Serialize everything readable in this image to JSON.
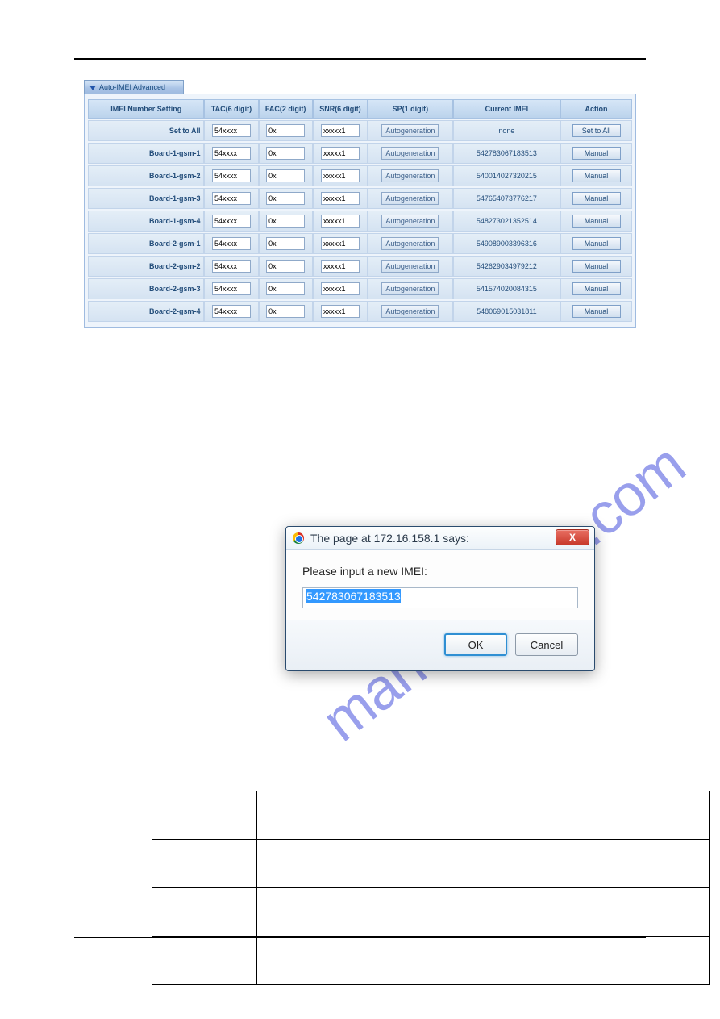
{
  "panel_title": "Auto-IMEI Advanced",
  "headers": {
    "setting": "IMEI Number Setting",
    "tac": "TAC(6 digit)",
    "fac": "FAC(2 digit)",
    "snr": "SNR(6 digit)",
    "sp": "SP(1 digit)",
    "current": "Current IMEI",
    "action": "Action"
  },
  "autogen_label": "Autogeneration",
  "set_to_all_label": "Set to All",
  "manual_label": "Manual",
  "rows": [
    {
      "label": "Set to All",
      "tac": "54xxxx",
      "fac": "0x",
      "snr": "xxxxx1",
      "imei": "none",
      "action": "settoall"
    },
    {
      "label": "Board-1-gsm-1",
      "tac": "54xxxx",
      "fac": "0x",
      "snr": "xxxxx1",
      "imei": "542783067183513",
      "action": "manual"
    },
    {
      "label": "Board-1-gsm-2",
      "tac": "54xxxx",
      "fac": "0x",
      "snr": "xxxxx1",
      "imei": "540014027320215",
      "action": "manual"
    },
    {
      "label": "Board-1-gsm-3",
      "tac": "54xxxx",
      "fac": "0x",
      "snr": "xxxxx1",
      "imei": "547654073776217",
      "action": "manual"
    },
    {
      "label": "Board-1-gsm-4",
      "tac": "54xxxx",
      "fac": "0x",
      "snr": "xxxxx1",
      "imei": "548273021352514",
      "action": "manual"
    },
    {
      "label": "Board-2-gsm-1",
      "tac": "54xxxx",
      "fac": "0x",
      "snr": "xxxxx1",
      "imei": "549089003396316",
      "action": "manual"
    },
    {
      "label": "Board-2-gsm-2",
      "tac": "54xxxx",
      "fac": "0x",
      "snr": "xxxxx1",
      "imei": "542629034979212",
      "action": "manual"
    },
    {
      "label": "Board-2-gsm-3",
      "tac": "54xxxx",
      "fac": "0x",
      "snr": "xxxxx1",
      "imei": "541574020084315",
      "action": "manual"
    },
    {
      "label": "Board-2-gsm-4",
      "tac": "54xxxx",
      "fac": "0x",
      "snr": "xxxxx1",
      "imei": "548069015031811",
      "action": "manual"
    }
  ],
  "prompt": {
    "title": "The page at 172.16.158.1 says:",
    "message": "Please input a new IMEI:",
    "value": "542783067183513",
    "ok": "OK",
    "cancel": "Cancel",
    "close": "X"
  },
  "watermark": "manualshive.com"
}
